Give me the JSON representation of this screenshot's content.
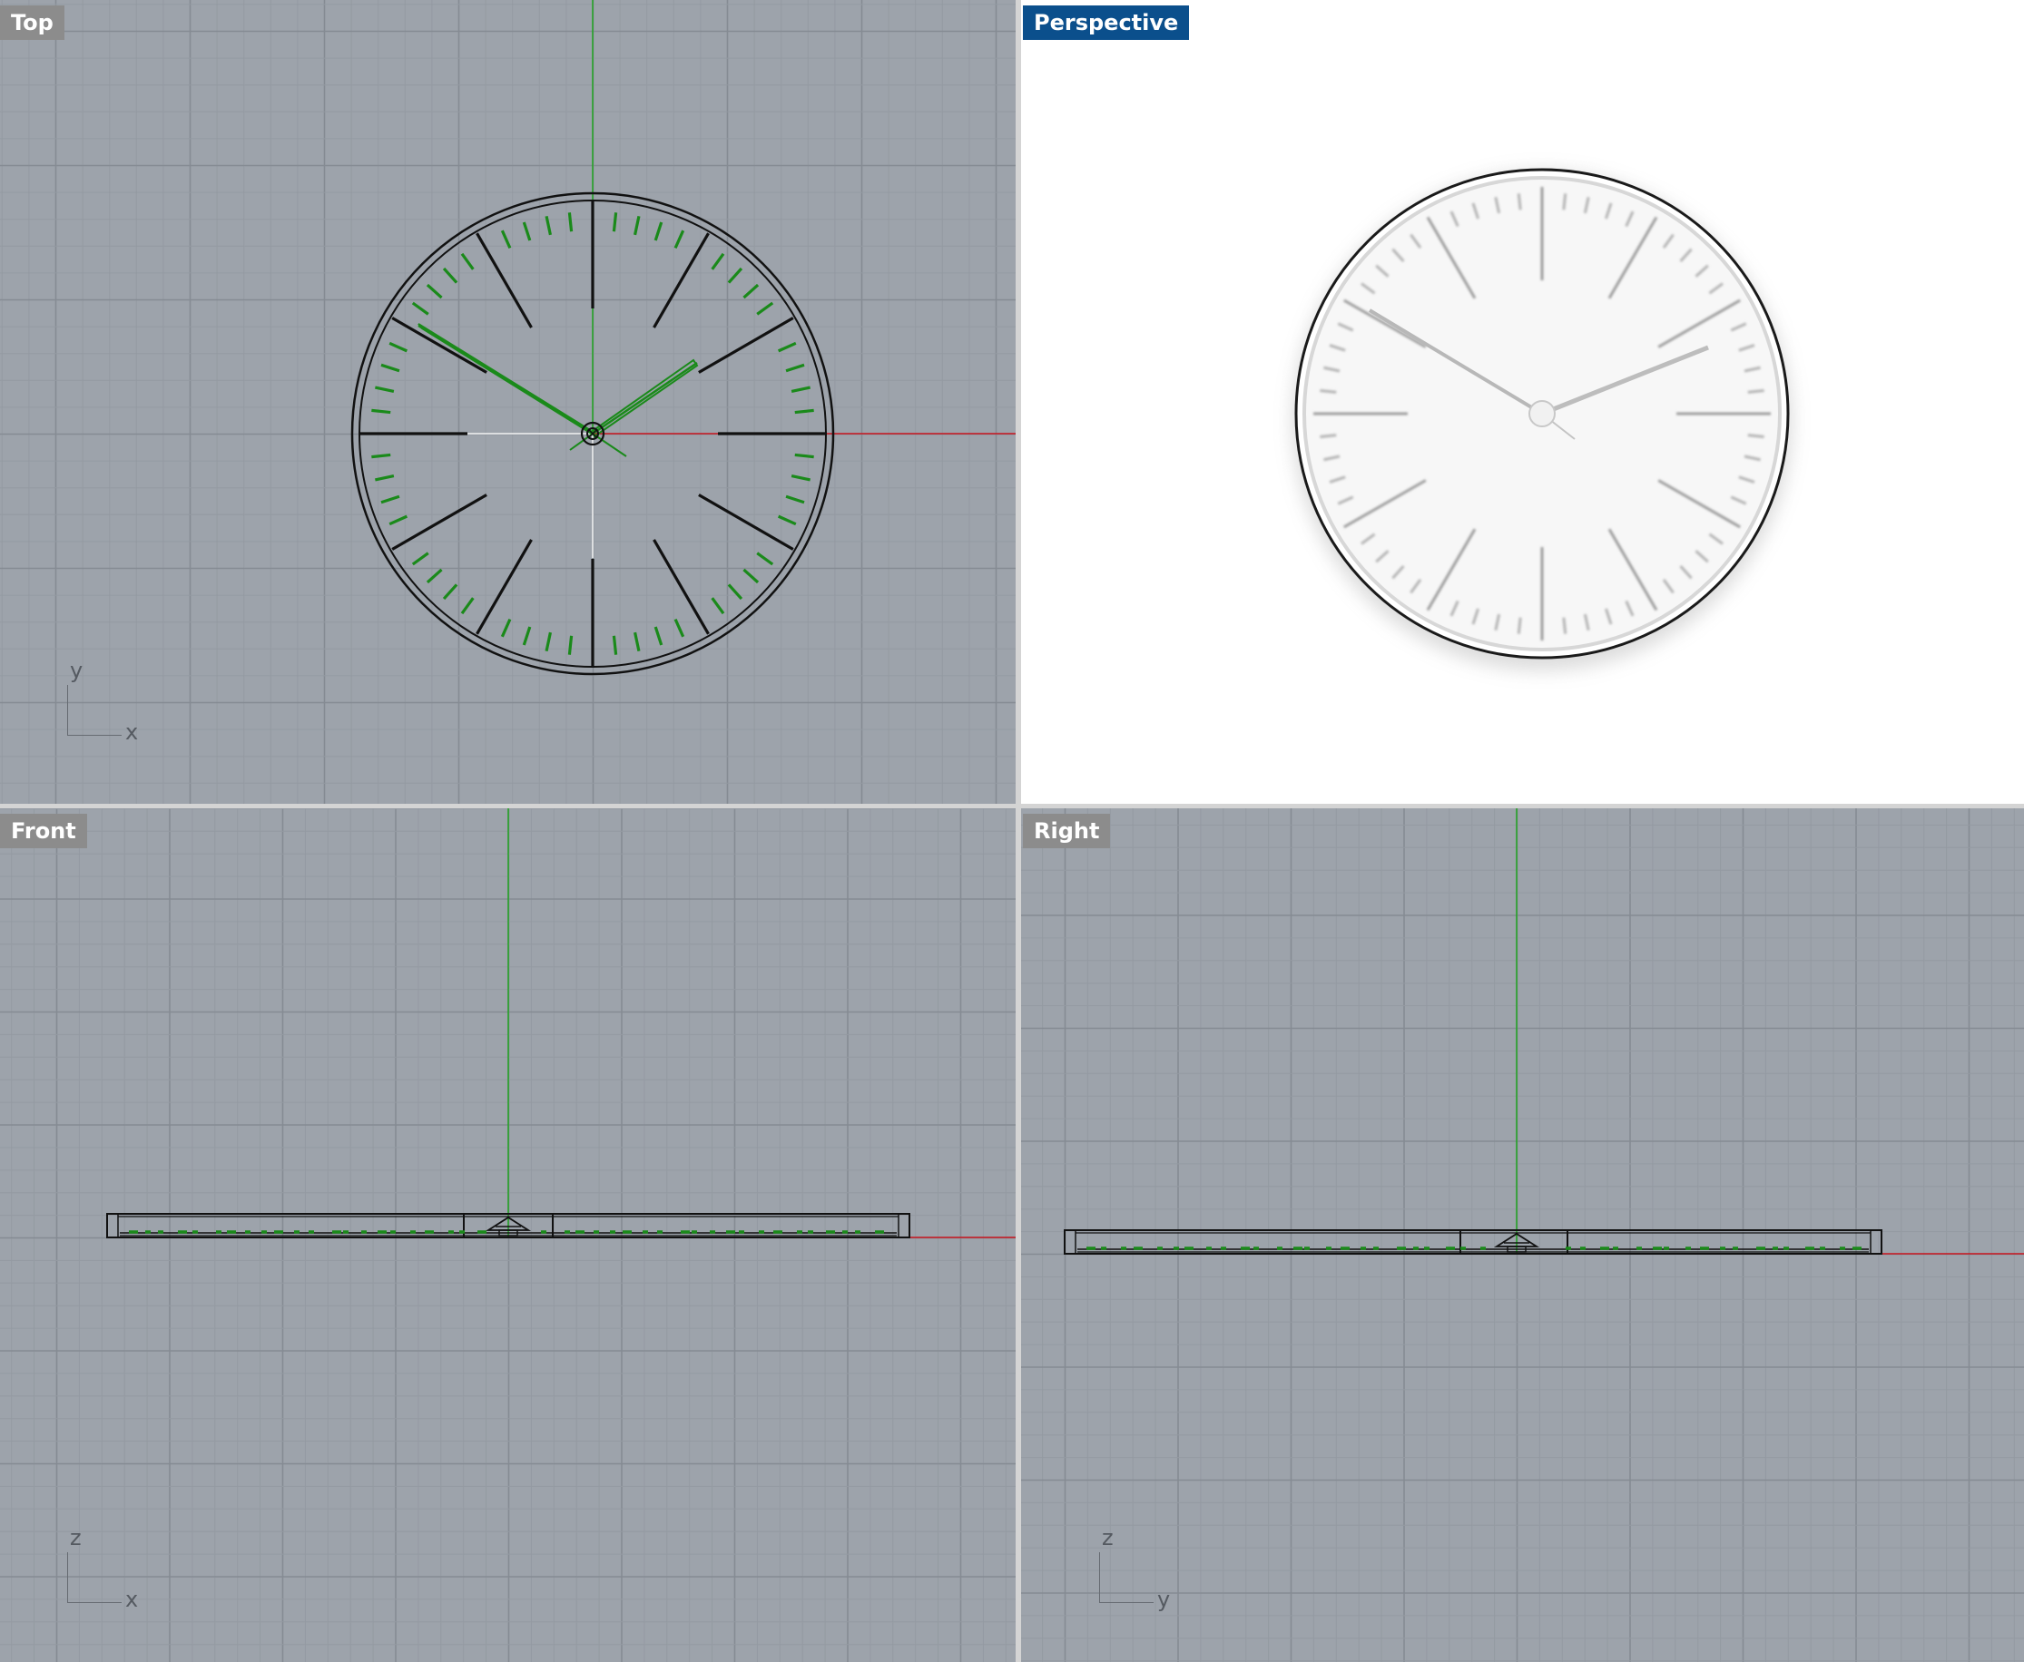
{
  "app": "Rhino",
  "viewports": {
    "top": {
      "label": "Top",
      "axis_h": "x",
      "axis_v": "y"
    },
    "perspective": {
      "label": "Perspective",
      "active": true
    },
    "front": {
      "label": "Front",
      "axis_h": "x",
      "axis_v": "z"
    },
    "right": {
      "label": "Right",
      "axis_h": "y",
      "axis_v": "z"
    }
  },
  "colors": {
    "viewport_bg": "#9da3ab",
    "grid_minor": "#949aa2",
    "grid_major": "#858b93",
    "x_axis": "#c8141e",
    "y_axis": "#1fa31f",
    "curve": "#111111",
    "selected": "#1a8a1a",
    "active_label": "#0b4f8c",
    "inactive_label": "#8c8c8c"
  },
  "icons": [
    "cplane-axes-icon"
  ]
}
